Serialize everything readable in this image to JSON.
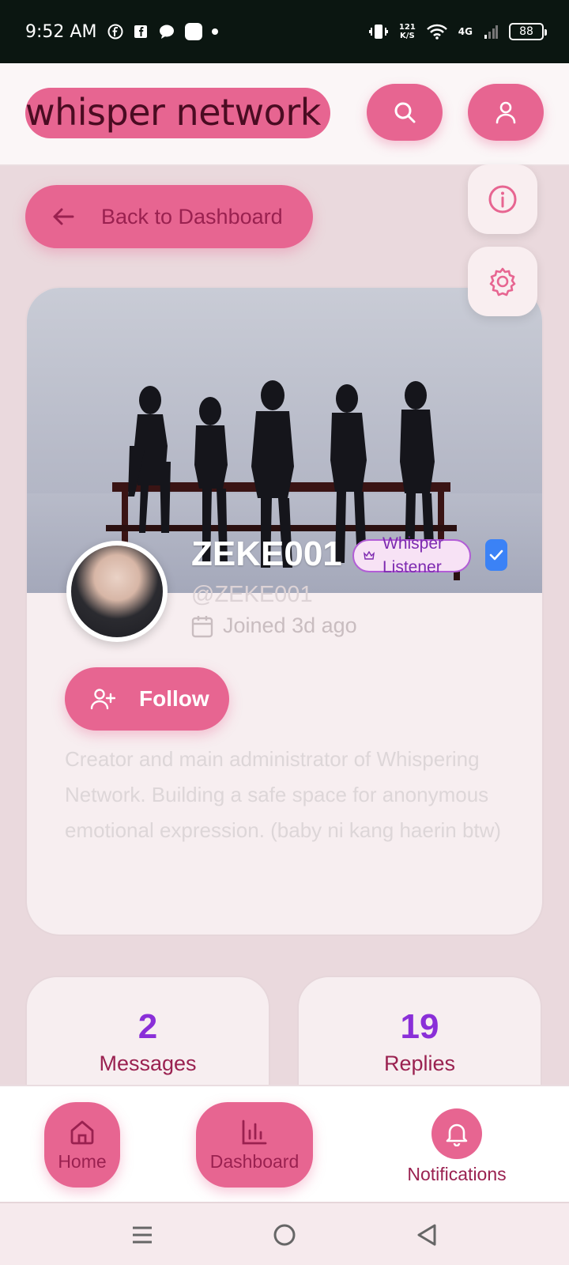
{
  "status_bar": {
    "time": "9:52 AM",
    "speed_value": "121",
    "speed_unit": "K/S",
    "network": "4G",
    "battery": "88"
  },
  "header": {
    "brand": "whisper network",
    "search_icon": "search-icon",
    "profile_icon": "user-icon"
  },
  "side_actions": {
    "info_icon": "info-icon",
    "settings_icon": "gear-icon"
  },
  "back_button": {
    "label": "Back to Dashboard"
  },
  "profile": {
    "username": "ZEKE001",
    "badge": "Whisper Listener",
    "handle": "@ZEKE001",
    "joined": "Joined 3d ago",
    "follow_label": "Follow",
    "bio": "Creator and main administrator of Whispering Network. Building a safe space for anonymous emotional expression. (baby ni kang haerin btw)"
  },
  "stats": [
    {
      "value": "2",
      "label": "Messages"
    },
    {
      "value": "19",
      "label": "Replies"
    }
  ],
  "bottom_nav": [
    {
      "label": "Home",
      "icon": "home-icon"
    },
    {
      "label": "Dashboard",
      "icon": "bar-chart-icon"
    },
    {
      "label": "Notifications",
      "icon": "bell-icon"
    }
  ],
  "colors": {
    "accent": "#e76591",
    "accent_text": "#9a2150",
    "stat_number": "#8a2fd8",
    "background": "#ead9dd"
  }
}
